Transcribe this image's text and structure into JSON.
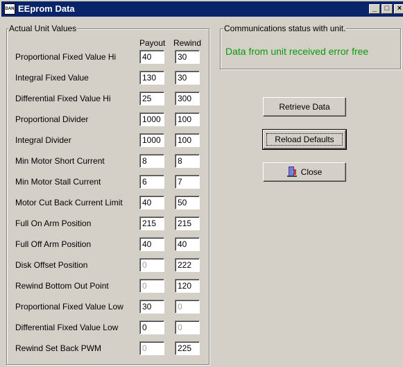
{
  "window": {
    "title": "EEprom Data",
    "icon_text": "DAN"
  },
  "actual_values": {
    "group_title": "Actual Unit Values",
    "col_payout": "Payout",
    "col_rewind": "Rewind",
    "rows": [
      {
        "label": "Proportional Fixed Value Hi",
        "payout": "40",
        "rewind": "30"
      },
      {
        "label": "Integral Fixed Value",
        "payout": "130",
        "rewind": "30"
      },
      {
        "label": "Differential Fixed Value Hi",
        "payout": "25",
        "rewind": "300"
      },
      {
        "label": "Proportional Divider",
        "payout": "1000",
        "rewind": "100"
      },
      {
        "label": "Integral Divider",
        "payout": "1000",
        "rewind": "100"
      },
      {
        "label": "Min Motor Short Current",
        "payout": "8",
        "rewind": "8"
      },
      {
        "label": "Min Motor Stall Current",
        "payout": "6",
        "rewind": "7"
      },
      {
        "label": "Motor Cut Back Current Limit",
        "payout": "40",
        "rewind": "50"
      },
      {
        "label": "Full On Arm Position",
        "payout": "215",
        "rewind": "215"
      },
      {
        "label": "Full Off Arm Position",
        "payout": "40",
        "rewind": "40"
      },
      {
        "label": "Disk Offset Position",
        "payout": "0",
        "rewind": "222"
      },
      {
        "label": "Rewind Bottom Out Point",
        "payout": "0",
        "rewind": "120"
      },
      {
        "label": "Proportional Fixed Value Low",
        "payout": "30",
        "rewind": "0"
      },
      {
        "label": "Differential Fixed Value Low",
        "payout": "0",
        "rewind": "0"
      },
      {
        "label": "Rewind Set Back PWM",
        "payout": "0",
        "rewind": "225"
      }
    ]
  },
  "comms": {
    "group_title": "Communications status with unit.",
    "status": "Data from unit received error free",
    "status_color": "#0a9a0a"
  },
  "buttons": {
    "retrieve": "Retrieve Data",
    "reload": "Reload Defaults",
    "close": "Close"
  }
}
